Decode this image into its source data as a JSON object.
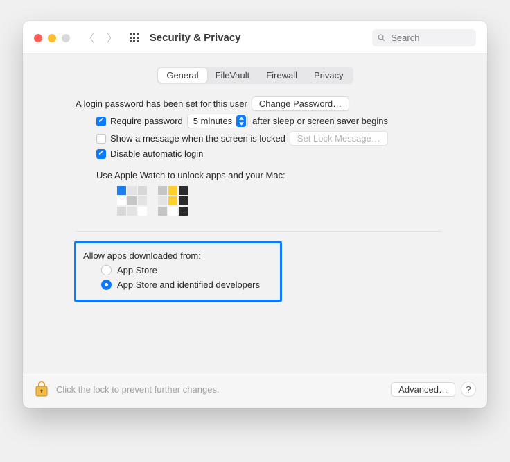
{
  "title": "Security & Privacy",
  "search": {
    "placeholder": "Search"
  },
  "tabs": {
    "general": "General",
    "filevault": "FileVault",
    "firewall": "Firewall",
    "privacy": "Privacy",
    "active": "general"
  },
  "login": {
    "password_set_text": "A login password has been set for this user",
    "change_password_btn": "Change Password…",
    "require_label": "Require password",
    "require_delay": "5 minutes",
    "require_suffix": "after sleep or screen saver begins",
    "require_checked": true,
    "show_message_label": "Show a message when the screen is locked",
    "show_message_checked": false,
    "set_lock_message_btn": "Set Lock Message…",
    "disable_auto_login_label": "Disable automatic login",
    "disable_auto_login_checked": true,
    "watch_text": "Use Apple Watch to unlock apps and your Mac:"
  },
  "allow_apps": {
    "heading": "Allow apps downloaded from:",
    "option_appstore": "App Store",
    "option_identified": "App Store and identified developers",
    "selected": "identified"
  },
  "footer": {
    "lock_text": "Click the lock to prevent further changes.",
    "advanced_btn": "Advanced…",
    "help": "?"
  },
  "colors": {
    "accent": "#0a7aff"
  }
}
